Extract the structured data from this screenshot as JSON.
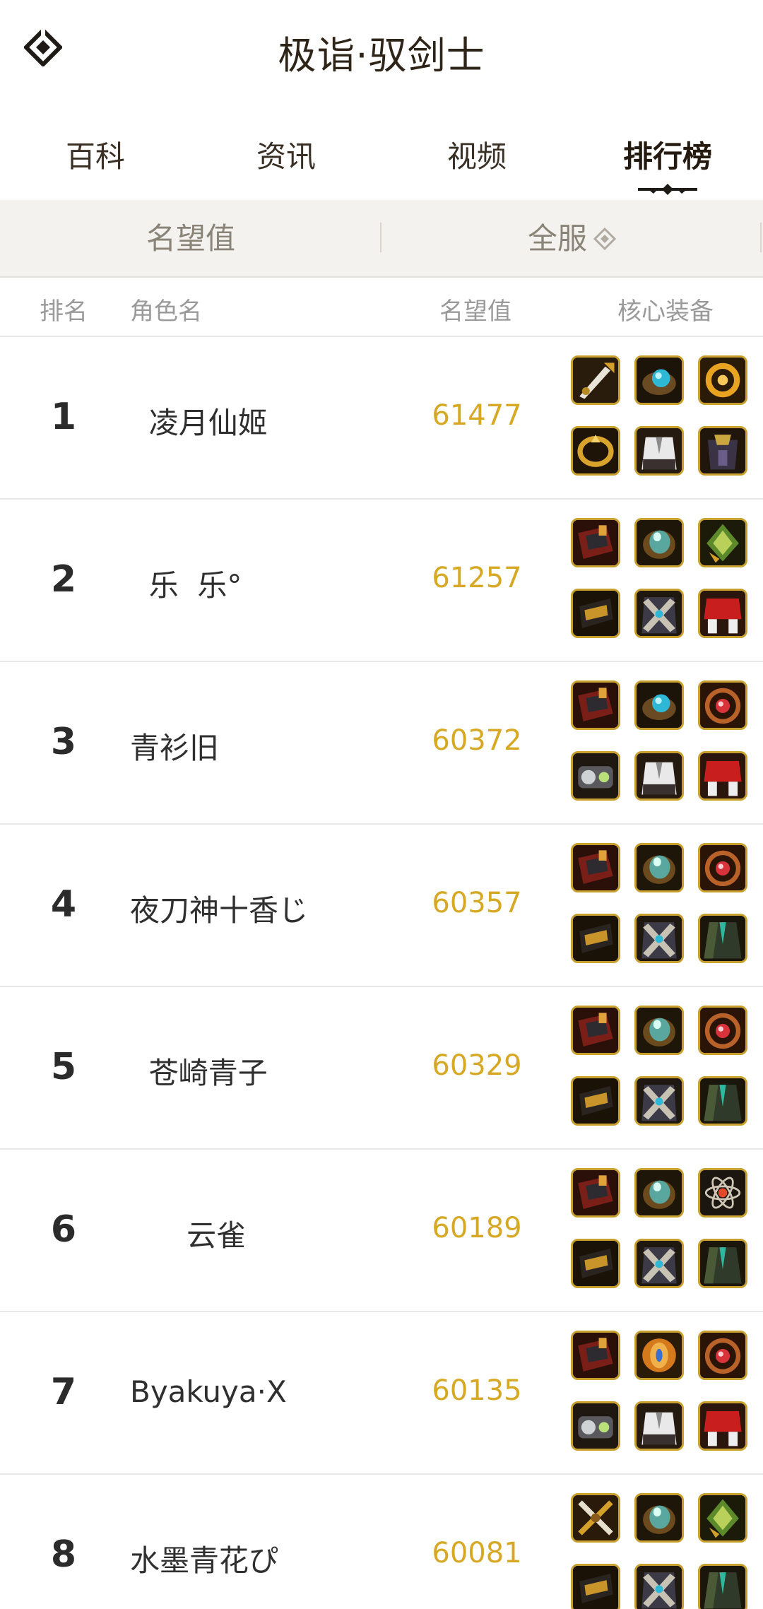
{
  "app": {
    "title": "极诣·驭剑士"
  },
  "tabs": [
    {
      "label": "百科"
    },
    {
      "label": "资讯"
    },
    {
      "label": "视频"
    },
    {
      "label": "排行榜",
      "active": true
    }
  ],
  "filters": {
    "metric": "名望值",
    "server": "全服"
  },
  "columns": {
    "rank": "排名",
    "name": "角色名",
    "score": "名望值",
    "equipment": "核心装备"
  },
  "ranking": [
    {
      "rank": "1",
      "name": "  凌月仙姬",
      "score": "61477",
      "equipment": [
        "sword-weapon-icon",
        "blue-orb-bracer-icon",
        "golden-ring-icon",
        "golden-bracelet-icon",
        "white-coat-icon",
        "dark-armor-icon"
      ]
    },
    {
      "rank": "2",
      "name": "  乐  乐°",
      "score": "61257",
      "equipment": [
        "red-gauntlet-icon",
        "green-orb-bracer-icon",
        "green-leaf-icon",
        "dark-bracer-icon",
        "cross-belt-icon",
        "red-skirt-icon"
      ]
    },
    {
      "rank": "3",
      "name": "青衫旧",
      "score": "60372",
      "equipment": [
        "red-gauntlet-icon",
        "blue-orb-bracer-icon",
        "ruby-ring-icon",
        "gear-device-icon",
        "white-coat-icon",
        "red-skirt-icon"
      ]
    },
    {
      "rank": "4",
      "name": "夜刀神十香じ",
      "score": "60357",
      "equipment": [
        "red-gauntlet-icon",
        "green-orb-bracer-icon",
        "ruby-ring-icon",
        "dark-bracer-icon",
        "cross-belt-icon",
        "green-robe-icon"
      ]
    },
    {
      "rank": "5",
      "name": "  苍崎青子",
      "score": "60329",
      "equipment": [
        "red-gauntlet-icon",
        "green-orb-bracer-icon",
        "ruby-ring-icon",
        "dark-bracer-icon",
        "cross-belt-icon",
        "green-robe-icon"
      ]
    },
    {
      "rank": "6",
      "name": "      云雀",
      "score": "60189",
      "equipment": [
        "red-gauntlet-icon",
        "green-orb-bracer-icon",
        "atom-orb-icon",
        "dark-bracer-icon",
        "cross-belt-icon",
        "green-robe-icon"
      ]
    },
    {
      "rank": "7",
      "name": "Byakuya·X",
      "score": "60135",
      "equipment": [
        "red-gauntlet-icon",
        "amber-gem-icon",
        "ruby-ring-icon",
        "gear-device-icon",
        "white-coat-icon",
        "red-skirt-icon"
      ]
    },
    {
      "rank": "8",
      "name": "水墨青花ぴ",
      "score": "60081",
      "equipment": [
        "cross-blade-icon",
        "green-orb-bracer-icon",
        "green-leaf-icon",
        "dark-bracer-icon",
        "cross-belt-icon",
        "green-robe-icon"
      ]
    }
  ],
  "colors": {
    "accent": "#d6a823",
    "filter_bg": "#f3f2ee",
    "title": "#2e2418"
  }
}
